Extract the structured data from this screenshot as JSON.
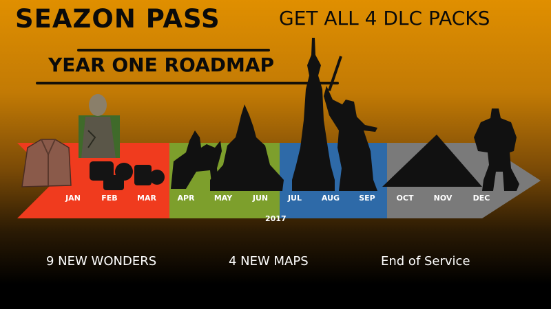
{
  "header": {
    "title": "SEAZON PASS",
    "tagline": "GET ALL 4 DLC PACKS",
    "roadmap_title": "YEAR ONE ROADMAP"
  },
  "timeline": {
    "months": [
      "JAN",
      "FEB",
      "MAR",
      "APR",
      "MAY",
      "JUN",
      "JUL",
      "AUG",
      "SEP",
      "OCT",
      "NOV",
      "DEC"
    ],
    "year": "2017",
    "segment_colors": {
      "q1": "#f03b1e",
      "q2": "#7d9f2c",
      "q3": "#2e6aa8",
      "q4": "#7a7a7a"
    }
  },
  "captions": {
    "wonders": "9 NEW WONDERS",
    "maps": "4 NEW MAPS",
    "end": "End of Service"
  },
  "icons": [
    "leather-jacket-icon",
    "buddha-statue-icon",
    "camera-gear-icon",
    "equestrian-statue-icon",
    "seated-buddha-icon",
    "tower-spire-icon",
    "motherland-statue-icon",
    "pyramid-icon",
    "mecha-robot-icon"
  ]
}
